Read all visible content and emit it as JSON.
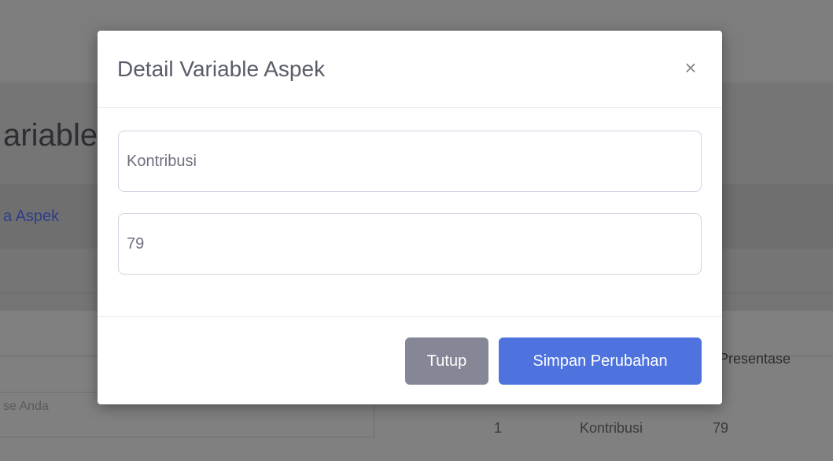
{
  "background": {
    "page_title": "ariable",
    "card_link": "a Aspek",
    "search_label": "se Anda",
    "table_header": "Presentase",
    "row": {
      "number": "1",
      "name": "Kontribusi",
      "value": "79"
    }
  },
  "modal": {
    "title": "Detail Variable Aspek",
    "close_symbol": "×",
    "fields": {
      "aspect_name": "Kontribusi",
      "percentage": "79"
    },
    "buttons": {
      "close_label": "Tutup",
      "save_label": "Simpan Perubahan"
    }
  },
  "colors": {
    "primary": "#4e73df",
    "secondary": "#858796",
    "overlay": "#7f7f7f"
  }
}
